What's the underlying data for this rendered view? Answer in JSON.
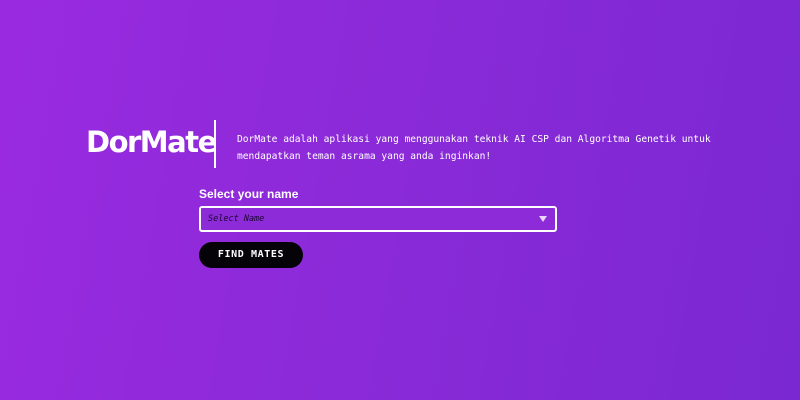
{
  "brand": {
    "name": "DorMate",
    "description": "DorMate adalah aplikasi yang menggunakan teknik AI CSP dan Algoritma Genetik untuk mendapatkan teman asrama yang anda inginkan!"
  },
  "form": {
    "label": "Select your name",
    "select": {
      "placeholder": "Select Name",
      "selected_value": ""
    },
    "submit_label": "FIND MATES"
  },
  "colors": {
    "background_start": "#9a2ae0",
    "background_end": "#7a28d2",
    "button_background": "#050208",
    "text": "#ffffff"
  },
  "icons": {
    "select_caret": "chevron-down-icon"
  }
}
